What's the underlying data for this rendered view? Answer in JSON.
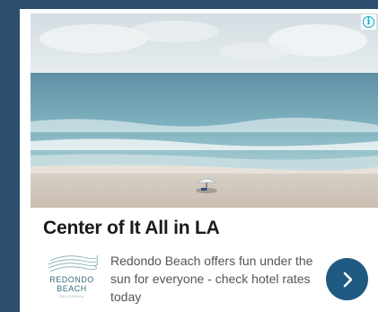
{
  "ad": {
    "headline": "Center of It All in LA",
    "body": "Redondo Beach offers fun under the sun for everyone - check hotel rates today",
    "logo": {
      "line1": "REDONDO",
      "line2": "BEACH",
      "line3": "CALIFORNIA"
    },
    "info_icon": "info-icon",
    "cta_icon": "chevron-right-icon",
    "colors": {
      "background": "#2b4f6c",
      "cta": "#1f5a82",
      "info": "#00aecd",
      "headline": "#1a1a1a",
      "body": "#555555"
    }
  }
}
